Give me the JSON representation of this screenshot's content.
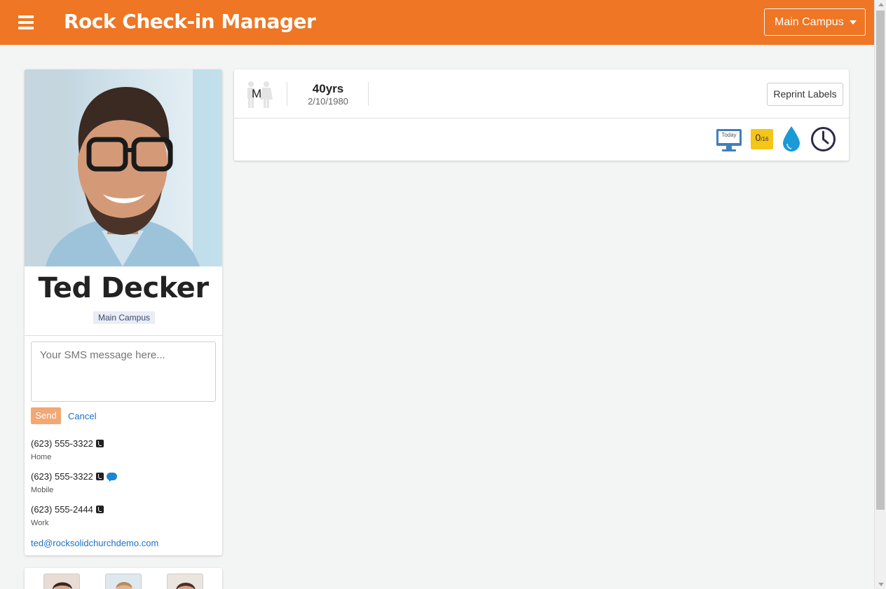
{
  "header": {
    "title": "Rock Check-in Manager",
    "campus_selector": "Main Campus"
  },
  "profile": {
    "name": "Ted Decker",
    "campus": "Main Campus",
    "sms_placeholder": "Your SMS message here...",
    "send_label": "Send",
    "cancel_label": "Cancel",
    "phones": [
      {
        "number": "(623) 555-3322",
        "type": "Home",
        "sms": false
      },
      {
        "number": "(623) 555-3322",
        "type": "Mobile",
        "sms": true
      },
      {
        "number": "(623) 555-2444",
        "type": "Work",
        "sms": false
      }
    ],
    "email": "ted@rocksolidchurchdemo.com"
  },
  "summary": {
    "gender": "M",
    "age": "40yrs",
    "birthdate": "2/10/1980",
    "reprint_label": "Reprint Labels",
    "today_label": "Today",
    "checkin_count": "0",
    "checkin_total": "/16"
  },
  "colors": {
    "brand": "#ee7624",
    "link": "#1d70c7",
    "badge": "#f5c518"
  },
  "icons": [
    "menu-icon",
    "caret-down-icon",
    "gender-icon",
    "monitor-icon",
    "water-drop-icon",
    "clock-icon",
    "phone-icon",
    "sms-icon"
  ]
}
